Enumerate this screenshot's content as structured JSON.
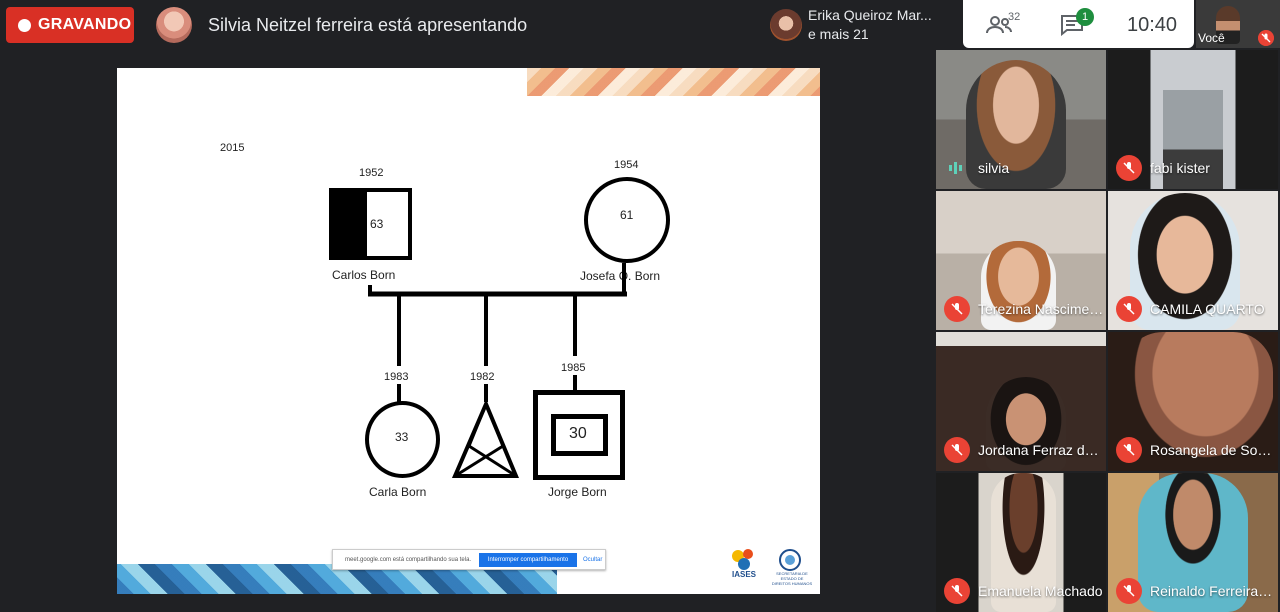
{
  "topbar": {
    "recording_label": "GRAVANDO",
    "presenter_text": "Silvia Neitzel ferreira está apresentando",
    "others_line1": "Erika Queiroz Mar...",
    "others_line2": "e mais 21",
    "people_count": "32",
    "chat_count": "1",
    "clock": "10:40",
    "self_label": "Você"
  },
  "slide": {
    "year_top": "2015",
    "father": {
      "year": "1952",
      "age": "63",
      "name": "Carlos Born"
    },
    "mother": {
      "year": "1954",
      "age": "61",
      "name": "Josefa O. Born"
    },
    "child1": {
      "year": "1983",
      "age": "33",
      "name": "Carla Born"
    },
    "child2": {
      "year": "1982"
    },
    "child3": {
      "year": "1985",
      "age": "30",
      "name": "Jorge Born"
    },
    "share_bar": {
      "text": "meet.google.com está compartilhando sua tela.",
      "stop_label": "Interromper compartilhamento",
      "hide_label": "Ocultar"
    },
    "logo_text": "IASES",
    "seal_text": "SECRETARIA DE ESTADO DE DIREITOS HUMANOS"
  },
  "participants": [
    {
      "name": "silvia",
      "muted": false
    },
    {
      "name": "fabi kister",
      "muted": true
    },
    {
      "name": "Terezina Nascimen...",
      "muted": true
    },
    {
      "name": "CAMILA QUARTO",
      "muted": true
    },
    {
      "name": "Jordana Ferraz da ...",
      "muted": true
    },
    {
      "name": "Rosangela de Souz...",
      "muted": true
    },
    {
      "name": "Emanuela Machado",
      "muted": true
    },
    {
      "name": "Reinaldo Ferreira d...",
      "muted": true
    }
  ],
  "colors": {
    "record": "#d93025",
    "mute": "#ea4335",
    "chat_badge": "#1e8e3e",
    "accent": "#1a73e8"
  }
}
